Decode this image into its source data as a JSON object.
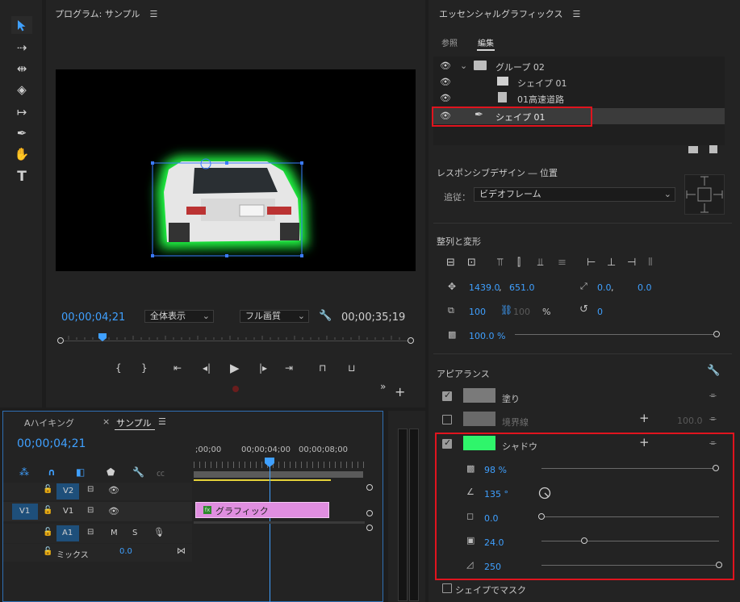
{
  "program_monitor": {
    "title": "プログラム: サンプル",
    "timecode_current": "00;00;04;21",
    "zoom_option": "全体表示",
    "quality_option": "フル画質",
    "timecode_duration": "00;00;35;19"
  },
  "essential_graphics": {
    "title": "エッセンシャルグラフィックス",
    "tabs": [
      "参照",
      "編集"
    ],
    "active_tab": "編集",
    "layers": {
      "group": "グループ 02",
      "shape_in_group": "シェイプ 01",
      "clip": "01高速道路",
      "selected_shape": "シェイプ 01"
    },
    "responsive": {
      "heading": "レスポンシブデザイン ― 位置",
      "follow_label": "追従：",
      "follow_value": "ビデオフレーム"
    },
    "align": {
      "heading": "整列と変形",
      "pos_x": "1439.0",
      "pos_sep": ",",
      "pos_y": "651.0",
      "anchor_x": "0.0",
      "anchor_sep": ",",
      "anchor_y": "0.0",
      "scale": "100",
      "scale_linked": "100",
      "scale_unit": "%",
      "rotation": "0",
      "opacity": "100.0 %",
      "opacity_fraction": 1.0
    },
    "appearance": {
      "heading": "アピアランス",
      "fill_label": "塗り",
      "fill_color": "#7a7a7a",
      "stroke_label": "境界線",
      "stroke_value": "100.0",
      "stroke_color": "#7a7a7a",
      "shadow_label": "シャドウ",
      "shadow_color": "#2ff56b",
      "shadow_opacity": "98 %",
      "shadow_opacity_fraction": 0.98,
      "shadow_angle": "135 °",
      "shadow_distance": "0.0",
      "shadow_distance_fraction": 0.0,
      "shadow_size": "24.0",
      "shadow_size_fraction": 0.24,
      "shadow_blur": "250",
      "shadow_blur_fraction": 1.0,
      "mask_label": "シェイプでマスク"
    }
  },
  "timeline": {
    "tab_inactive": "Aハイキング",
    "tab_active": "サンプル",
    "close_glyph": "×",
    "timecode": "00;00;04;21",
    "ruler": [
      ";00;00",
      "00;00;04;00",
      "00;00;08;00"
    ],
    "clip_label": "グラフィック",
    "clip_badge": "fx",
    "tracks": {
      "v2": "V2",
      "v1_source": "V1",
      "v1": "V1",
      "a1": "A1",
      "mute": "M",
      "solo": "S",
      "mix": "ミックス",
      "mix_value": "0.0"
    }
  }
}
